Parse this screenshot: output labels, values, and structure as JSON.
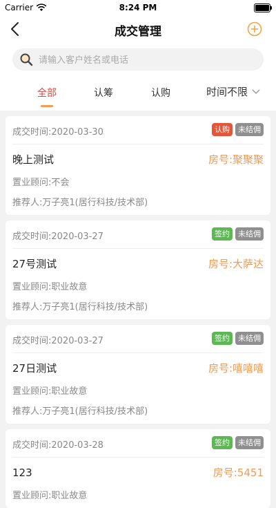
{
  "status_bar": {
    "carrier": "Carrier",
    "time": "8:24 PM"
  },
  "navbar": {
    "title": "成交管理"
  },
  "search": {
    "placeholder": "请输入客户姓名或电话"
  },
  "tabs": {
    "all": "全部",
    "subscribe": "认筹",
    "purchase": "认购",
    "time_filter": "时间不限"
  },
  "deals": [
    {
      "date_label": "成交时间:2020-03-30",
      "status": "认购",
      "status_color": "#e4553a",
      "commission": "未结佣",
      "customer": "晚上测试",
      "room": "房号:聚聚聚",
      "consultant": "置业顾问:不会",
      "referrer": "推荐人:万子亮1(居行科技/技术部)"
    },
    {
      "date_label": "成交时间:2020-03-27",
      "status": "签约",
      "status_color": "#5cb852",
      "commission": "未结佣",
      "customer": "27号测试",
      "room": "房号:大萨达",
      "consultant": "置业顾问:职业故意",
      "referrer": "推荐人:万子亮1(居行科技/技术部)"
    },
    {
      "date_label": "成交时间:2020-03-27",
      "status": "签约",
      "status_color": "#5cb852",
      "commission": "未结佣",
      "customer": "27日测试",
      "room": "房号:嘻嘻嘻",
      "consultant": "置业顾问:职业故意",
      "referrer": "推荐人:万子亮1(居行科技/技术部)"
    },
    {
      "date_label": "成交时间:2020-03-28",
      "status": "签约",
      "status_color": "#5cb852",
      "commission": "未结佣",
      "customer": "123",
      "room": "房号:5451",
      "consultant": "置业顾问:职业故意",
      "referrer": ""
    }
  ]
}
